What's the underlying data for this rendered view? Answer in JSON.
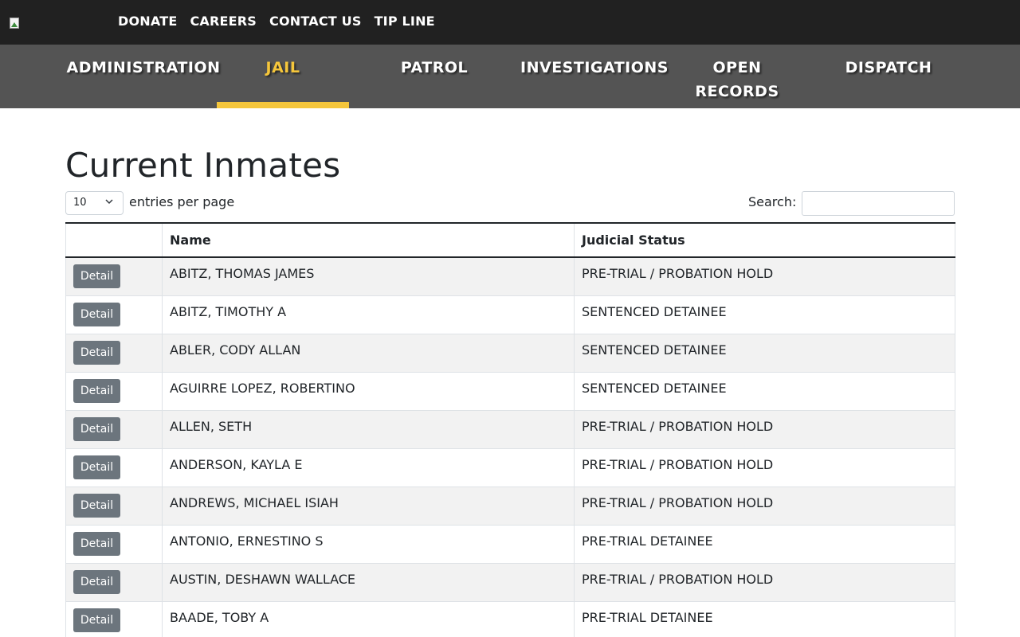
{
  "top_links": [
    "DONATE",
    "CAREERS",
    "CONTACT US",
    "TIP LINE"
  ],
  "main_nav": [
    {
      "label": "ADMINISTRATION"
    },
    {
      "label": "JAIL",
      "active": true
    },
    {
      "label": "PATROL"
    },
    {
      "label": "INVESTIGATIONS"
    },
    {
      "label": "OPEN RECORDS"
    },
    {
      "label": "DISPATCH"
    }
  ],
  "page": {
    "title": "Current Inmates"
  },
  "controls": {
    "entries_value": "10",
    "entries_label": "entries per page",
    "search_label": "Search:",
    "search_value": ""
  },
  "table": {
    "headers": [
      "",
      "Name",
      "Judicial Status"
    ],
    "button_label": "Detail",
    "rows": [
      {
        "name": "ABITZ, THOMAS JAMES",
        "status": "PRE-TRIAL / PROBATION HOLD"
      },
      {
        "name": "ABITZ, TIMOTHY A",
        "status": "SENTENCED DETAINEE"
      },
      {
        "name": "ABLER, CODY ALLAN",
        "status": "SENTENCED DETAINEE"
      },
      {
        "name": "AGUIRRE LOPEZ, ROBERTINO",
        "status": "SENTENCED DETAINEE"
      },
      {
        "name": "ALLEN, SETH",
        "status": "PRE-TRIAL / PROBATION HOLD"
      },
      {
        "name": "ANDERSON, KAYLA E",
        "status": "PRE-TRIAL / PROBATION HOLD"
      },
      {
        "name": "ANDREWS, MICHAEL ISIAH",
        "status": "PRE-TRIAL / PROBATION HOLD"
      },
      {
        "name": "ANTONIO, ERNESTINO S",
        "status": "PRE-TRIAL DETAINEE"
      },
      {
        "name": "AUSTIN, DESHAWN WALLACE",
        "status": "PRE-TRIAL / PROBATION HOLD"
      },
      {
        "name": "BAADE, TOBY A",
        "status": "PRE-TRIAL DETAINEE"
      }
    ]
  },
  "colors": {
    "topbar": "#212121",
    "nav": "#545454",
    "accent": "#f5c63b",
    "button": "#6c757d"
  }
}
